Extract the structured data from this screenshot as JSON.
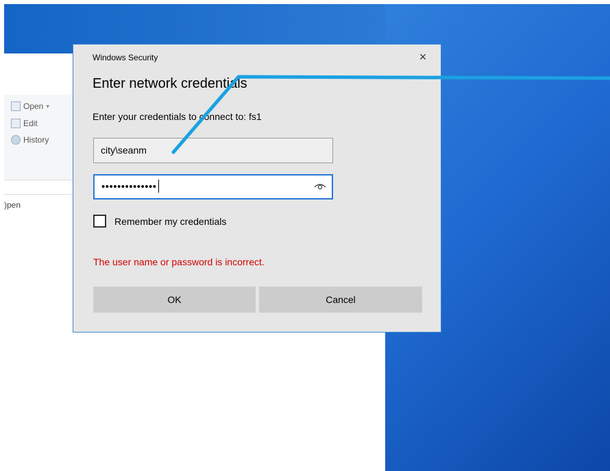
{
  "explorer": {
    "ribbon": {
      "open_label": "Open",
      "edit_label": "Edit",
      "history_label": "History",
      "group_label": ")pen"
    }
  },
  "dialog": {
    "title": "Windows Security",
    "close_icon_glyph": "×",
    "heading": "Enter network credentials",
    "description": "Enter your credentials to connect to: fs1",
    "username_value": "city\\seanm",
    "password_mask": "••••••••••••••",
    "reveal_icon": "eye-icon",
    "remember_label": "Remember my credentials",
    "remember_checked": false,
    "error_text": "The user name or password is incorrect.",
    "ok_label": "OK",
    "cancel_label": "Cancel"
  },
  "colors": {
    "desktop_blue": "#1f6ad1",
    "dialog_border": "#3e86d3",
    "error_red": "#d10000",
    "focus_border": "#2a78d6",
    "annotation_line": "#1ba1e2"
  }
}
